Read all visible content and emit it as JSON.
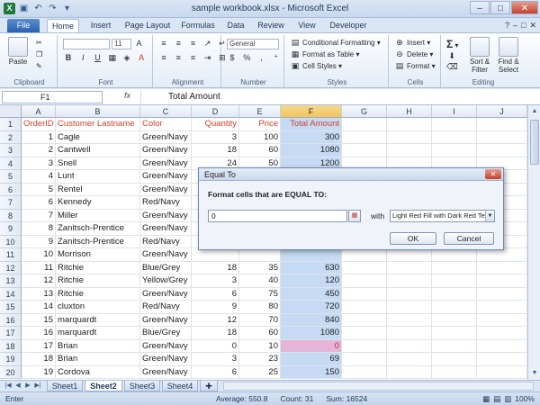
{
  "window": {
    "title": "sample workbook.xlsx  -  Microsoft Excel",
    "logo": "X",
    "minimize": "–",
    "maximize": "□",
    "close": "✕"
  },
  "tabs": {
    "file": "File",
    "home": "Home",
    "insert": "Insert",
    "page_layout": "Page Layout",
    "formulas": "Formulas",
    "data": "Data",
    "review": "Review",
    "view": "View",
    "developer": "Developer"
  },
  "ribbon": {
    "clipboard": {
      "label": "Clipboard",
      "paste": "Paste"
    },
    "font": {
      "label": "Font",
      "size": "11",
      "bold": "B",
      "italic": "I",
      "underline": "U",
      "grow": "A",
      "shrink": "A"
    },
    "alignment": {
      "label": "Alignment"
    },
    "number": {
      "label": "Number",
      "format": "General",
      "currency": "$",
      "percent": "%",
      "comma": ","
    },
    "styles": {
      "label": "Styles",
      "conditional": "Conditional Formatting",
      "format_table": "Format as Table",
      "cell_styles": "Cell Styles"
    },
    "cells": {
      "label": "Cells",
      "insert": "Insert",
      "delete": "Delete",
      "format": "Format"
    },
    "editing": {
      "label": "Editing",
      "sort": "Sort & Filter",
      "find": "Find & Select"
    }
  },
  "formula_bar": {
    "name_box": "F1",
    "fx": "fx",
    "content": "Total Amount"
  },
  "columns": [
    "A",
    "B",
    "C",
    "D",
    "E",
    "F",
    "G",
    "H",
    "I",
    "J"
  ],
  "header_row": [
    "OrderID",
    "Customer Lastname",
    "Color",
    "Quantity",
    "Price",
    "Total Amount"
  ],
  "rows": [
    [
      "1",
      "Cagle",
      "Green/Navy",
      "3",
      "100",
      "300"
    ],
    [
      "2",
      "Cantwell",
      "Green/Navy",
      "18",
      "60",
      "1080"
    ],
    [
      "3",
      "Snell",
      "Green/Navy",
      "24",
      "50",
      "1200"
    ],
    [
      "4",
      "Lunt",
      "Green/Navy",
      "",
      "",
      ""
    ],
    [
      "5",
      "Rentel",
      "Green/Navy",
      "",
      "",
      ""
    ],
    [
      "6",
      "Kennedy",
      "Red/Navy",
      "",
      "",
      ""
    ],
    [
      "7",
      "Miller",
      "Green/Navy",
      "",
      "",
      ""
    ],
    [
      "8",
      "Zanitsch-Prentice",
      "Green/Navy",
      "",
      "",
      ""
    ],
    [
      "9",
      "Zanitsch-Prentice",
      "Red/Navy",
      "",
      "",
      ""
    ],
    [
      "10",
      "Morrison",
      "Green/Navy",
      "",
      "",
      ""
    ],
    [
      "11",
      "Ritchie",
      "Blue/Grey",
      "18",
      "35",
      "630"
    ],
    [
      "12",
      "Ritchie",
      "Yellow/Grey",
      "3",
      "40",
      "120"
    ],
    [
      "13",
      "Ritchie",
      "Green/Navy",
      "6",
      "75",
      "450"
    ],
    [
      "14",
      "cluxton",
      "Red/Navy",
      "9",
      "80",
      "720"
    ],
    [
      "15",
      "marquardt",
      "Green/Navy",
      "12",
      "70",
      "840"
    ],
    [
      "16",
      "marquardt",
      "Blue/Grey",
      "18",
      "60",
      "1080"
    ],
    [
      "17",
      "Brian",
      "Green/Navy",
      "0",
      "10",
      "0"
    ],
    [
      "18",
      "Brian",
      "Green/Navy",
      "3",
      "23",
      "69"
    ],
    [
      "19",
      "Cordova",
      "Green/Navy",
      "6",
      "25",
      "150"
    ]
  ],
  "row_numbers": [
    "1",
    "2",
    "3",
    "4",
    "5",
    "6",
    "7",
    "8",
    "9",
    "10",
    "11",
    "12",
    "13",
    "14",
    "15",
    "16",
    "17",
    "18",
    "19",
    "20"
  ],
  "sheet_tabs": [
    "Sheet1",
    "Sheet2",
    "Sheet3",
    "Sheet4"
  ],
  "active_sheet": "Sheet2",
  "status": {
    "mode": "Enter",
    "average": "Average: 550.8",
    "count": "Count: 31",
    "sum": "Sum: 16524",
    "zoom": "100%"
  },
  "dialog": {
    "title": "Equal To",
    "heading": "Format cells that are EQUAL TO:",
    "value": "0",
    "with_label": "with",
    "format_option": "Light Red Fill with Dark Red Text",
    "ok": "OK",
    "cancel": "Cancel"
  },
  "colors": {
    "header_text": "#d0402a",
    "selected_column": "#c6dbf3",
    "highlight_fill": "#e6b4d6"
  }
}
